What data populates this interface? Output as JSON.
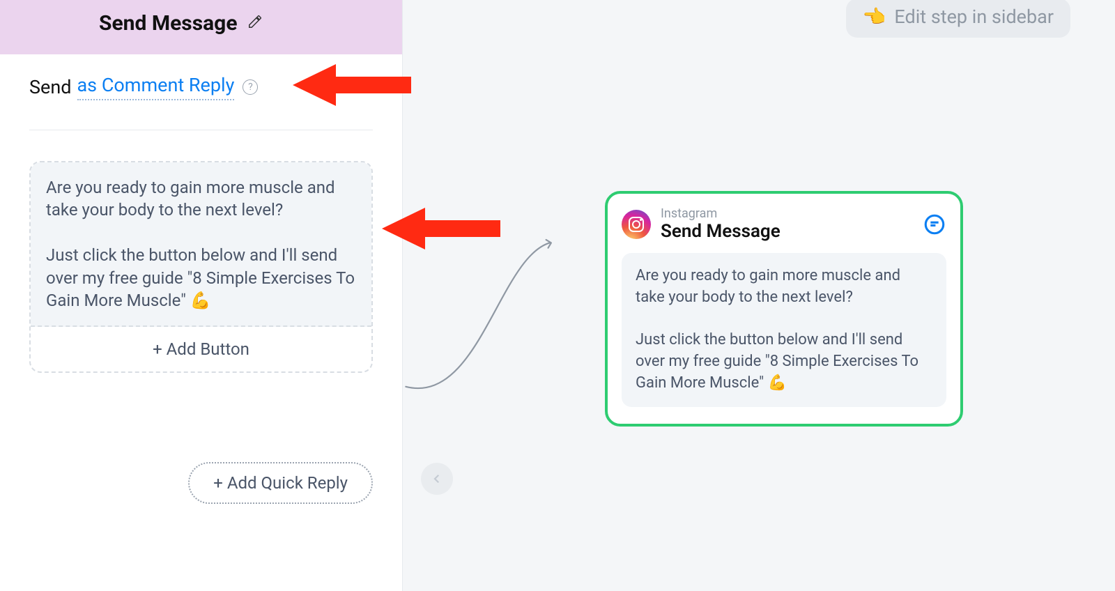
{
  "sidebar": {
    "title": "Send Message",
    "send_prefix": "Send",
    "send_mode": "as Comment Reply",
    "message_text": "Are you ready to gain more muscle and take your body to the next level?\n\nJust click the button below and I'll send over my free guide \"8 Simple Exercises To Gain More Muscle\" 💪",
    "add_button_label": "+ Add Button",
    "add_quick_reply_label": "+ Add Quick Reply"
  },
  "canvas": {
    "edit_hint_emoji": "👈",
    "edit_hint": "Edit step in sidebar",
    "node": {
      "platform": "Instagram",
      "title": "Send Message",
      "body": "Are you ready to gain more muscle and take your body to the next level?\n\nJust click the button below and I'll send over my free guide \"8 Simple Exercises To Gain More Muscle\" 💪"
    }
  }
}
